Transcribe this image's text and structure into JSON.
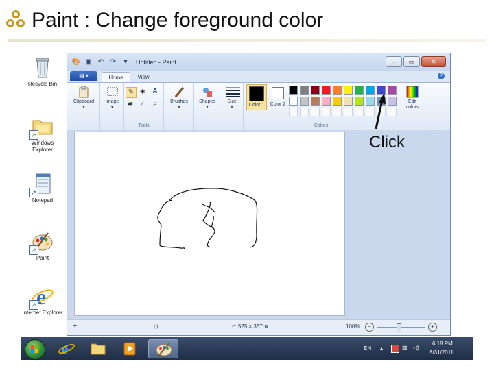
{
  "slide": {
    "title": "Paint : Change foreground color",
    "callout_text": "Click",
    "colors": {
      "accent": "#c49a1a",
      "rule": "#e8e3cf"
    }
  },
  "desktop": {
    "icons": [
      {
        "label": "Recycle Bin",
        "icon": "recycle-bin-icon"
      },
      {
        "label": "Windows Explorer",
        "icon": "folder-icon"
      },
      {
        "label": "Notepad",
        "icon": "notepad-icon"
      },
      {
        "label": "Paint",
        "icon": "paint-palette-icon"
      },
      {
        "label": "Internet Explorer",
        "icon": "ie-icon"
      }
    ]
  },
  "paint": {
    "window_title": "Untitled - Paint",
    "tabs": [
      {
        "label": "Home",
        "active": true
      },
      {
        "label": "View",
        "active": false
      }
    ],
    "app_menu_label": "▤ ▾",
    "groups": {
      "clipboard": "Clipboard",
      "image": "Image",
      "tools": "Tools",
      "brushes": "Brushes",
      "shapes": "Shapes",
      "size": "Size",
      "color1": "Color 1",
      "color2": "Color 2",
      "colors": "Colors",
      "edit_colors": "Edit colors"
    },
    "palette_row1": [
      "#000000",
      "#7f7f7f",
      "#880015",
      "#ed1c24",
      "#ff7f27",
      "#fff200",
      "#22b14c",
      "#00a2e8",
      "#3f48cc",
      "#a349a4"
    ],
    "palette_row2": [
      "#ffffff",
      "#c3c3c3",
      "#b97a57",
      "#ffaec9",
      "#ffc90e",
      "#efe4b0",
      "#b5e61d",
      "#99d9ea",
      "#7092be",
      "#c8bfe7"
    ],
    "color1_value": "#000000",
    "color2_value": "#ffffff",
    "status": {
      "image_size": "525 × 357px",
      "zoom": "100%"
    }
  },
  "taskbar": {
    "language": "EN",
    "time": "6:18 PM",
    "date": "8/31/2011"
  }
}
